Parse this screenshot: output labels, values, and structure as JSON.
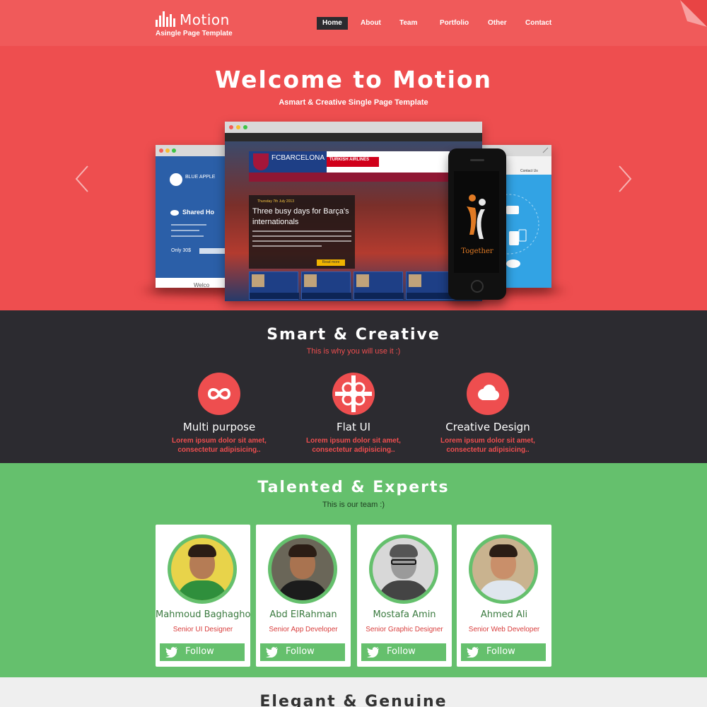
{
  "header": {
    "logo_title": "Motion",
    "logo_subtitle": "Asingle Page Template",
    "nav": [
      {
        "label": "Home",
        "active": true
      },
      {
        "label": "About",
        "active": false
      },
      {
        "label": "Team",
        "active": false
      },
      {
        "label": "Portfolio",
        "active": false
      },
      {
        "label": "Other",
        "active": false
      },
      {
        "label": "Contact",
        "active": false
      }
    ]
  },
  "hero": {
    "title": "Welcome to Motion",
    "subtitle": "Asmart & Creative Single Page Template",
    "left_arrow_icon": "chevron-left-icon",
    "right_arrow_icon": "chevron-right-icon",
    "mockup_left": {
      "brand": "BLUE APPLE",
      "heading": "Shared Ho",
      "price": "Only 30$",
      "footer": "Welco"
    },
    "mockup_main": {
      "club": "FCBARCELONA",
      "sponsor": "TURKISH AIRLINES",
      "date": "Thursday 7th July 2013",
      "headline": "Three busy days for Barça's internationals",
      "read_more": "Read more"
    },
    "mockup_right": {
      "contact": "Contact Us"
    },
    "phone_app": "Together"
  },
  "smart": {
    "title": "Smart & Creative",
    "subtitle": "This is why you will use it :)",
    "features": [
      {
        "icon": "infinity-icon",
        "title": "Multi purpose",
        "desc_line1": "Lorem ipsum dolor sit amet,",
        "desc_line2": "consectetur adipisicing.."
      },
      {
        "icon": "gift-icon",
        "title": "Flat UI",
        "desc_line1": "Lorem ipsum dolor sit amet,",
        "desc_line2": "consectetur adipisicing.."
      },
      {
        "icon": "cloud-icon",
        "title": "Creative Design",
        "desc_line1": "Lorem ipsum dolor sit amet,",
        "desc_line2": "consectetur adipisicing.."
      }
    ]
  },
  "team": {
    "title": "Talented & Experts",
    "subtitle": "This is our team :)",
    "members": [
      {
        "name": "Mahmoud Baghagho",
        "role": "Senior UI Designer",
        "follow": "Follow"
      },
      {
        "name": "Abd ElRahman",
        "role": "Senior App Developer",
        "follow": "Follow"
      },
      {
        "name": "Mostafa Amin",
        "role": "Senior Graphic Designer",
        "follow": "Follow"
      },
      {
        "name": "Ahmed Ali",
        "role": "Senior Web Developer",
        "follow": "Follow"
      }
    ]
  },
  "elegant": {
    "title": "Elegant & Genuine"
  },
  "colors": {
    "header_red": "#f05a5a",
    "hero_red": "#ee4e4f",
    "dark": "#2c2b30",
    "green": "#65c06d",
    "light_gray": "#efefef"
  }
}
